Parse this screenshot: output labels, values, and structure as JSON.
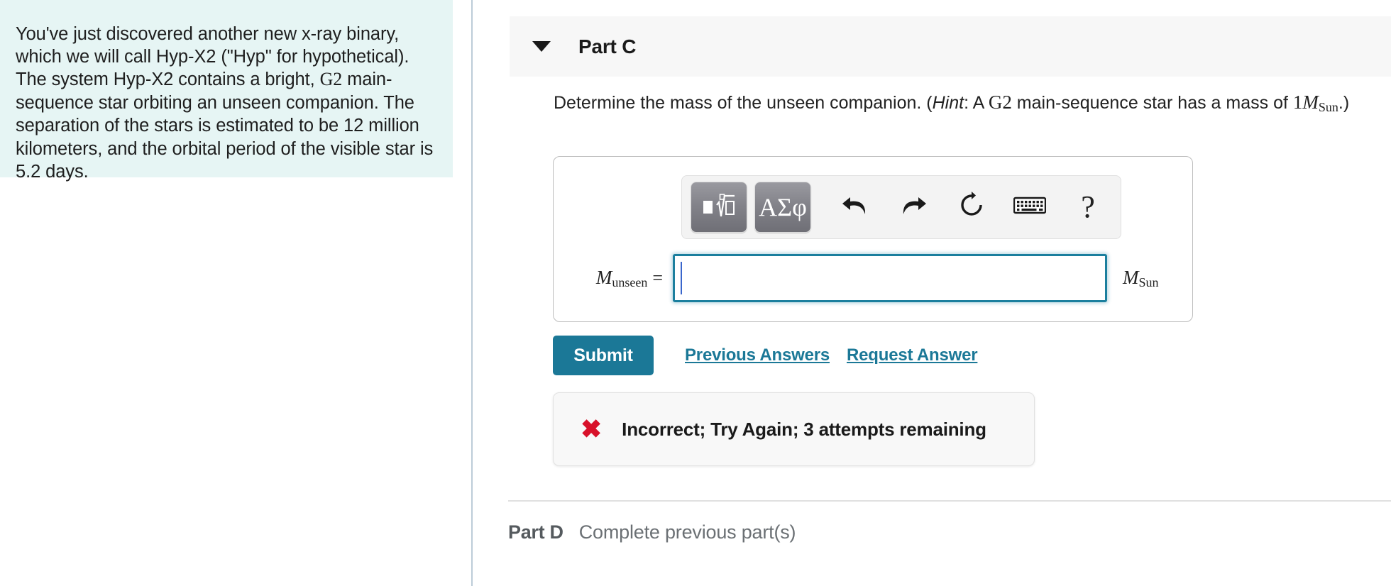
{
  "problem": {
    "text_before_g2": "You've just discovered another new x-ray binary, which we will call Hyp-X2 (\"Hyp\" for hypothetical). The system Hyp-X2 contains a bright, ",
    "g2": "G2",
    "text_after_g2": " main-sequence star orbiting an unseen companion. The separation of the stars is estimated to be 12 million kilometers, and the orbital period of the visible star is 5.2 days.",
    "background_color": "#e6f5f4"
  },
  "part_c": {
    "title": "Part C",
    "caret_icon": "triangle-down-icon",
    "header_background": "#f7f7f7",
    "question": {
      "lead": "Determine the mass of the unseen companion. (",
      "hint_label": "Hint",
      "mid": ": A ",
      "spectral_type": "G2",
      "after_type": " main-sequence star has a mass of ",
      "mass_number": "1",
      "mass_symbol": "M",
      "mass_subscript": "Sun",
      "tail": ".)"
    },
    "toolbar": {
      "template_button": "math-template-icon",
      "greek_button": "ΑΣφ",
      "undo_button": "undo-arrow-icon",
      "redo_button": "redo-arrow-icon",
      "reset_button": "reset-circle-icon",
      "keyboard_button": "keyboard-icon",
      "help_button": "?"
    },
    "answer": {
      "label_symbol": "M",
      "label_subscript": "unseen",
      "equals": "=",
      "value": "",
      "placeholder": "",
      "unit_symbol": "M",
      "unit_subscript": "Sun",
      "focus_border_color": "#1b7f9e",
      "caret_color": "#3a66cc"
    },
    "actions": {
      "submit_label": "Submit",
      "previous_answers_label": "Previous Answers",
      "request_answer_label": "Request Answer",
      "submit_color": "#1b7897",
      "link_color": "#1b7897"
    },
    "feedback": {
      "icon": "x-mark-icon",
      "icon_color": "#d8112a",
      "message": "Incorrect; Try Again; 3 attempts remaining"
    }
  },
  "part_d": {
    "title": "Part D",
    "status": "Complete previous part(s)"
  }
}
